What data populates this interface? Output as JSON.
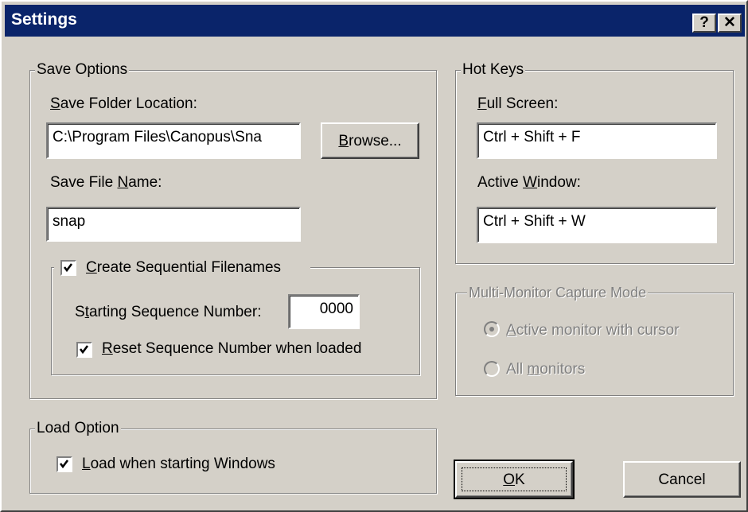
{
  "window": {
    "title": "Settings",
    "help_label": "?",
    "close_label": "✕"
  },
  "save_options": {
    "legend": "Save Options",
    "folder_label_prefix": "",
    "folder_label_accel": "S",
    "folder_label_rest": "ave Folder Location:",
    "folder_value": "C:\\Program Files\\Canopus\\Sna",
    "browse_accel": "B",
    "browse_rest": "rowse...",
    "file_label_prefix": "Save File ",
    "file_label_accel": "N",
    "file_label_rest": "ame:",
    "file_value": "snap",
    "sequential": {
      "checked": true,
      "label_accel": "C",
      "label_rest": "reate Sequential Filenames",
      "start_label_prefix": "S",
      "start_label_accel": "t",
      "start_label_rest": "arting Sequence Number:",
      "start_value": "0000",
      "reset_checked": true,
      "reset_label_accel": "R",
      "reset_label_rest": "eset Sequence Number when loaded"
    }
  },
  "hot_keys": {
    "legend": "Hot Keys",
    "full_label_accel": "F",
    "full_label_rest": "ull Screen:",
    "full_value": "Ctrl + Shift + F",
    "active_label_prefix": "Active ",
    "active_label_accel": "W",
    "active_label_rest": "indow:",
    "active_value": "Ctrl + Shift + W"
  },
  "multi_monitor": {
    "legend": "Multi-Monitor Capture Mode",
    "option1_accel": "A",
    "option1_rest": "ctive monitor with cursor",
    "option1_selected": true,
    "option2_prefix": "All ",
    "option2_accel": "m",
    "option2_rest": "onitors",
    "option2_selected": false,
    "enabled": false
  },
  "load_option": {
    "legend": "Load Option",
    "checked": true,
    "label_accel": "L",
    "label_rest": "oad when starting Windows"
  },
  "buttons": {
    "ok_accel": "O",
    "ok_rest": "K",
    "cancel": "Cancel"
  },
  "colors": {
    "titlebar": "#0a246a",
    "face": "#d4d0c8"
  }
}
